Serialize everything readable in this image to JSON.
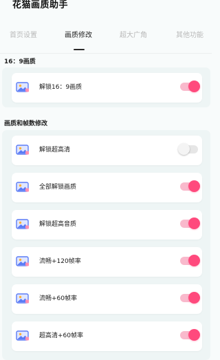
{
  "app": {
    "title": "花猫画质助手"
  },
  "tabs": [
    {
      "label": "首页设置",
      "active": false
    },
    {
      "label": "画质修改",
      "active": true
    },
    {
      "label": "超大广角",
      "active": false
    },
    {
      "label": "其他功能",
      "active": false
    }
  ],
  "sections": [
    {
      "title": "16：9画质",
      "items": [
        {
          "label": "解锁16：9画质",
          "enabled": true
        }
      ]
    },
    {
      "title": "画质和帧数修改",
      "items": [
        {
          "label": "解锁超高清",
          "enabled": false
        },
        {
          "label": "全部解锁画质",
          "enabled": true
        },
        {
          "label": "解锁超高音质",
          "enabled": true
        },
        {
          "label": "流畅+120帧率",
          "enabled": true
        },
        {
          "label": "流畅+60帧率",
          "enabled": true
        },
        {
          "label": "超高清+60帧率",
          "enabled": true
        }
      ]
    }
  ],
  "icons": {
    "row_icon": "image-icon"
  },
  "colors": {
    "accent": "#ff4a7d",
    "accent_track": "#f9b9cc",
    "off_track": "#e6e6e6",
    "section_bg": "#eef5f5",
    "tab_inactive": "#b9b9b9",
    "icon_blue": "#5b7cf5"
  }
}
